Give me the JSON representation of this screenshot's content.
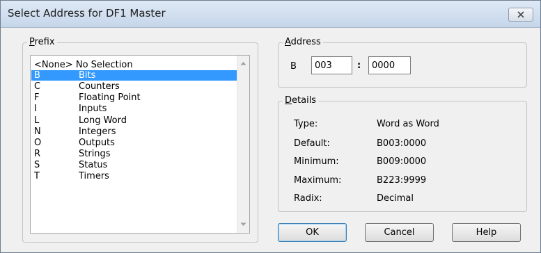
{
  "window": {
    "title": "Select Address for DF1 Master"
  },
  "prefix": {
    "group_label_accel": "P",
    "group_label_rest": "refix",
    "items": [
      {
        "code": "<None>",
        "desc": "No Selection"
      },
      {
        "code": "B",
        "desc": "Bits",
        "selected": true
      },
      {
        "code": "C",
        "desc": "Counters"
      },
      {
        "code": "F",
        "desc": "Floating Point"
      },
      {
        "code": "I",
        "desc": "Inputs"
      },
      {
        "code": "L",
        "desc": "Long Word"
      },
      {
        "code": "N",
        "desc": "Integers"
      },
      {
        "code": "O",
        "desc": "Outputs"
      },
      {
        "code": "R",
        "desc": "Strings"
      },
      {
        "code": "S",
        "desc": "Status"
      },
      {
        "code": "T",
        "desc": "Timers"
      }
    ]
  },
  "address": {
    "group_label_accel": "A",
    "group_label_rest": "ddress",
    "prefix": "B",
    "file_value": "003",
    "separator": ":",
    "element_value": "0000"
  },
  "details": {
    "group_label_accel": "D",
    "group_label_rest": "etails",
    "rows": [
      {
        "label": "Type:",
        "value": "Word as Word"
      },
      {
        "label": "Default:",
        "value": "B003:0000"
      },
      {
        "label": "Minimum:",
        "value": "B009:0000"
      },
      {
        "label": "Maximum:",
        "value": "B223:9999"
      },
      {
        "label": "Radix:",
        "value": "Decimal"
      }
    ]
  },
  "buttons": {
    "ok": "OK",
    "cancel": "Cancel",
    "help": "Help"
  },
  "icons": {
    "close": "close-icon",
    "scroll_up": "scroll-up-arrow-icon",
    "scroll_down": "scroll-down-arrow-icon"
  }
}
